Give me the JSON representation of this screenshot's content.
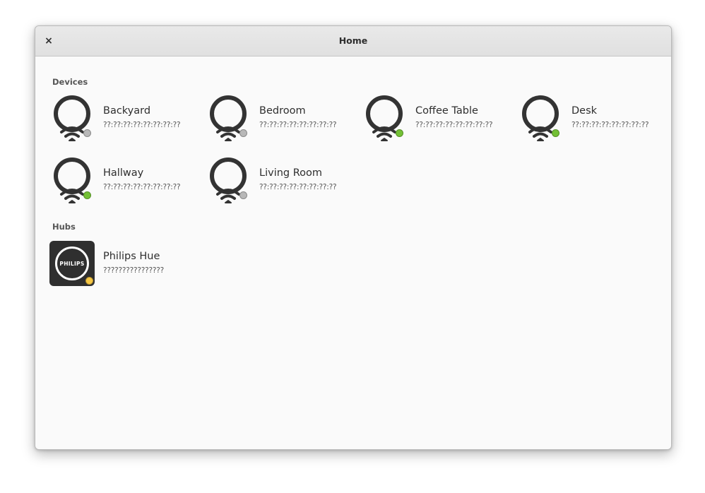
{
  "window": {
    "title": "Home",
    "close_label": "×"
  },
  "sections": {
    "devices_heading": "Devices",
    "hubs_heading": "Hubs"
  },
  "devices": [
    {
      "name": "Backyard",
      "address": "??:??:??:??:??:??:??:??",
      "status": "offline",
      "status_color": "#b8b8b8"
    },
    {
      "name": "Bedroom",
      "address": "??:??:??:??:??:??:??:??",
      "status": "offline",
      "status_color": "#b8b8b8"
    },
    {
      "name": "Coffee Table",
      "address": "??:??:??:??:??:??:??:??",
      "status": "online",
      "status_color": "#73c035"
    },
    {
      "name": "Desk",
      "address": "??:??:??:??:??:??:??:??",
      "status": "online",
      "status_color": "#73c035"
    },
    {
      "name": "Hallway",
      "address": "??:??:??:??:??:??:??:??",
      "status": "online",
      "status_color": "#73c035"
    },
    {
      "name": "Living Room",
      "address": "??:??:??:??:??:??:??:??",
      "status": "offline",
      "status_color": "#b8b8b8"
    }
  ],
  "hubs": [
    {
      "name": "Philips Hue",
      "id": "????????????????",
      "brand": "PHILIPS",
      "status": "pending",
      "status_color": "#f6c744"
    }
  ],
  "icons": {
    "close": "close-icon",
    "device": "smart-bulb-icon",
    "hub": "philips-hub-icon"
  }
}
